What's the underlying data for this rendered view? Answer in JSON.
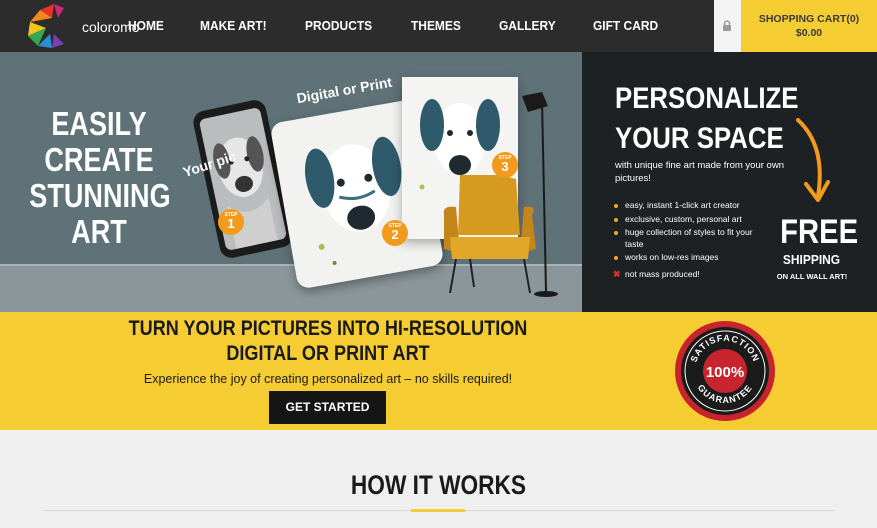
{
  "brand": {
    "name": "coloromo",
    "colors": {
      "nav": "#2c2c2c",
      "accent": "#f5cd32",
      "orange": "#f29a1c",
      "dark": "#1d2124"
    }
  },
  "nav": {
    "items": [
      {
        "label": "HOME"
      },
      {
        "label": "MAKE ART!"
      },
      {
        "label": "PRODUCTS"
      },
      {
        "label": "THEMES"
      },
      {
        "label": "GALLERY"
      },
      {
        "label": "GIFT CARD"
      }
    ],
    "lock_icon": "lock-icon",
    "cart": {
      "label": "SHOPPING CART(0)",
      "total": "$0.00"
    }
  },
  "hero": {
    "title_lines": [
      "EASILY",
      "CREATE",
      "STUNNING",
      "ART"
    ],
    "annotations": {
      "your_pic": "Your pic",
      "digital_or_print": "Digital or Print"
    },
    "steps": [
      {
        "label": "STEP",
        "number": "1"
      },
      {
        "label": "STEP",
        "number": "2"
      },
      {
        "label": "STEP",
        "number": "3"
      }
    ]
  },
  "promo": {
    "title_line1": "PERSONALIZE",
    "title_line2": "YOUR SPACE",
    "subtitle": "with unique fine art made from your own pictures!",
    "features": [
      "easy, instant 1-click art creator",
      "exclusive, custom, personal art",
      "huge collection of styles to fit your taste",
      "works on low-res images"
    ],
    "negative": "not mass produced!",
    "free": "FREE",
    "shipping": "SHIPPING",
    "wall_art": "ON ALL WALL ART!"
  },
  "banner": {
    "title": "TURN YOUR PICTURES INTO HI-RESOLUTION DIGITAL OR PRINT ART",
    "subtitle": "Experience the joy of creating personalized art – no skills required!",
    "cta": "GET STARTED",
    "seal": {
      "top": "SATISFACTION",
      "center": "100%",
      "bottom": "GUARANTEE"
    }
  },
  "how_it_works": {
    "title": "HOW IT WORKS"
  }
}
